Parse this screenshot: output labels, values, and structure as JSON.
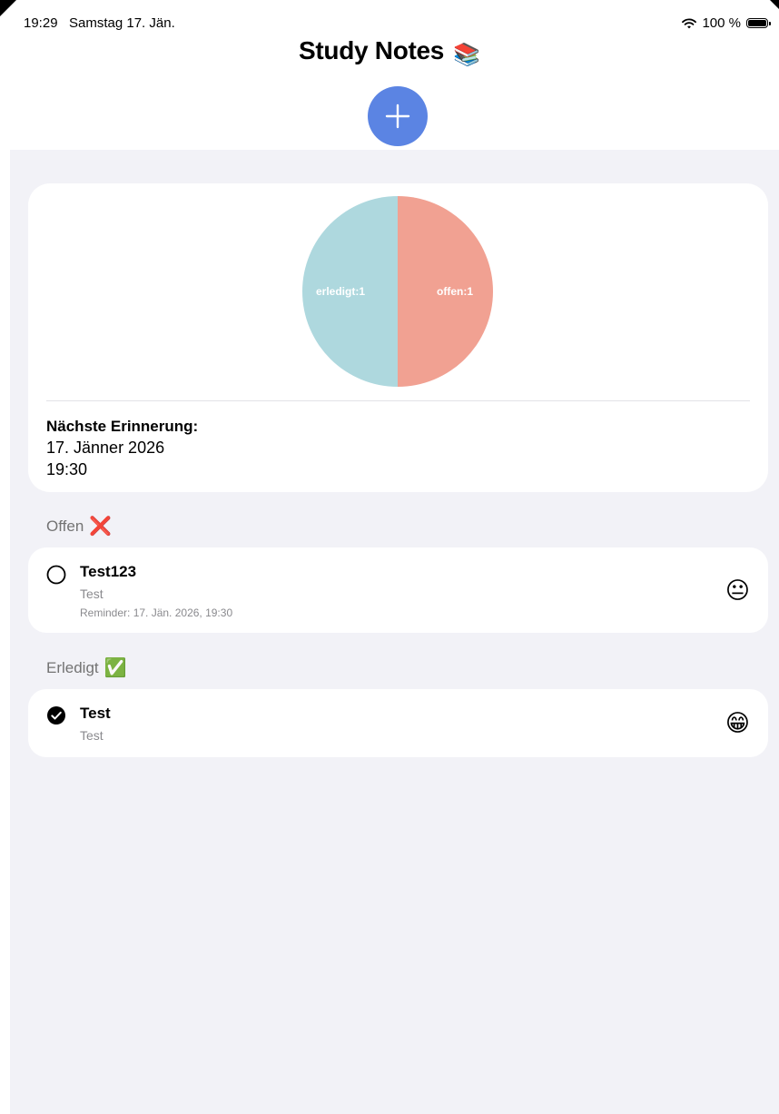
{
  "status_bar": {
    "time": "19:29",
    "date": "Samstag 17. Jän.",
    "battery": "100 %"
  },
  "header": {
    "title": "Study Notes",
    "title_emoji": "📚"
  },
  "summary": {
    "chart_data": {
      "type": "pie",
      "slices": [
        {
          "label": "erledigt:1",
          "value": 1,
          "color": "#aed8de"
        },
        {
          "label": "offen:1",
          "value": 1,
          "color": "#f1a192"
        }
      ]
    },
    "reminder_heading": "Nächste Erinnerung:",
    "reminder_date": "17. Jänner 2026",
    "reminder_time": "19:30"
  },
  "sections": {
    "open": {
      "label": "Offen",
      "emoji": "❌",
      "notes": [
        {
          "title": "Test123",
          "subtitle": "Test",
          "reminder": "Reminder: 17. Jän. 2026, 19:30",
          "mood": "😐",
          "done": false
        }
      ]
    },
    "done": {
      "label": "Erledigt",
      "emoji": "✅",
      "notes": [
        {
          "title": "Test",
          "subtitle": "Test",
          "mood": "😁",
          "done": true
        }
      ]
    }
  },
  "colors": {
    "accent": "#5b84e3",
    "background": "#f2f2f7",
    "card": "#ffffff",
    "secondary_text": "#8a8a8e"
  }
}
